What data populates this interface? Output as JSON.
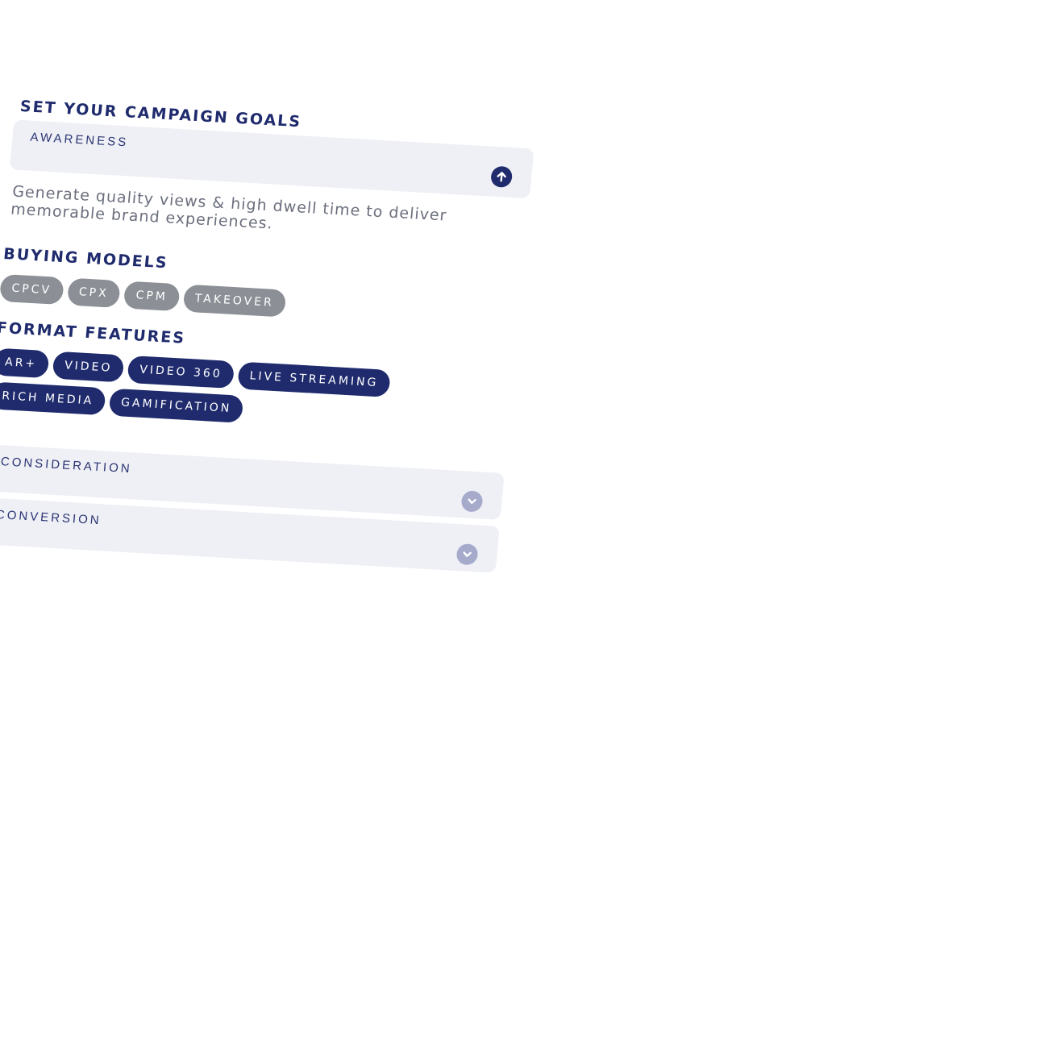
{
  "campaign": {
    "title": "SET YOUR CAMPAIGN GOALS",
    "goals": [
      {
        "label": "AWARENESS",
        "state": "expanded",
        "icon": "arrow-up-circle-icon"
      },
      {
        "label": "CONSIDERATION",
        "state": "collapsed",
        "icon": "chevron-down-circle-icon"
      },
      {
        "label": "CONVERSION",
        "state": "collapsed",
        "icon": "chevron-down-circle-icon"
      }
    ],
    "description": "Generate quality views & high dwell time to deliver memorable brand experiences."
  },
  "buying_models": {
    "title": "BUYING MODELS",
    "items": [
      "CPCV",
      "CPX",
      "CPM",
      "TAKEOVER"
    ]
  },
  "format_features": {
    "title": "FORMAT FEATURES",
    "items": [
      "AR+",
      "VIDEO",
      "VIDEO 360",
      "LIVE STREAMING",
      "RICH MEDIA",
      "GAMIFICATION"
    ]
  },
  "colors": {
    "primary": "#1f2b6d",
    "chip_grey": "#8c9096",
    "accordion_bg": "#eef0f5",
    "collapsed_icon": "#a6abcc",
    "body_text": "#6b6f7d"
  }
}
